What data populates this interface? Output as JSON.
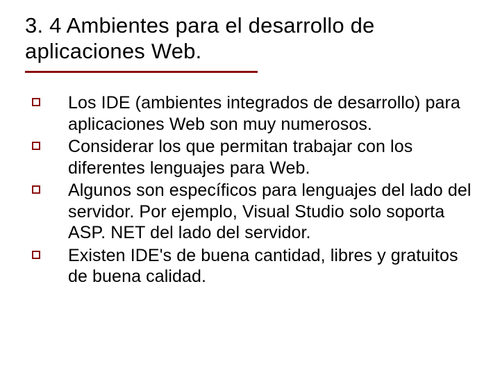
{
  "title": "3. 4 Ambientes para el desarrollo de aplicaciones Web.",
  "underline_color": "#8b0f0f",
  "bullets": [
    "Los IDE (ambientes integrados de desarrollo) para aplicaciones Web son muy numerosos.",
    "Considerar los que permitan trabajar con los diferentes lenguajes para Web.",
    "Algunos son específicos para lenguajes del lado del servidor. Por ejemplo, Visual Studio solo soporta ASP. NET del lado del servidor.",
    "Existen IDE's de  buena cantidad,  libres y gratuitos de buena calidad."
  ]
}
